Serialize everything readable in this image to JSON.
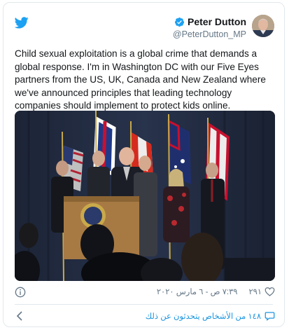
{
  "tweet": {
    "author_name": "Peter Dutton",
    "author_handle": "@PeterDutton_MP",
    "text": "Child sexual exploitation is a global crime that demands a global response. I'm in Washington DC with our Five Eyes partners from the US, UK, Canada and New Zealand where we've announced principles that leading technology companies should implement to protect kids online.",
    "like_count": "٢٩١",
    "timestamp": "٧:٣٩ ص - ٦ مارس ٢٠٢٠",
    "people_talking": "١٤٨ من الأشخاص يتحدثون عن ذلك"
  },
  "icons": {
    "brand": "twitter-bird-icon",
    "verified": "verified-badge-icon",
    "info": "info-icon",
    "like": "heart-icon",
    "talk": "comment-icon",
    "nav": "chevron-left-icon"
  },
  "colors": {
    "twitter_blue": "#1da1f2",
    "link_blue": "#1b95e0",
    "text": "#14171a",
    "secondary": "#657786"
  }
}
